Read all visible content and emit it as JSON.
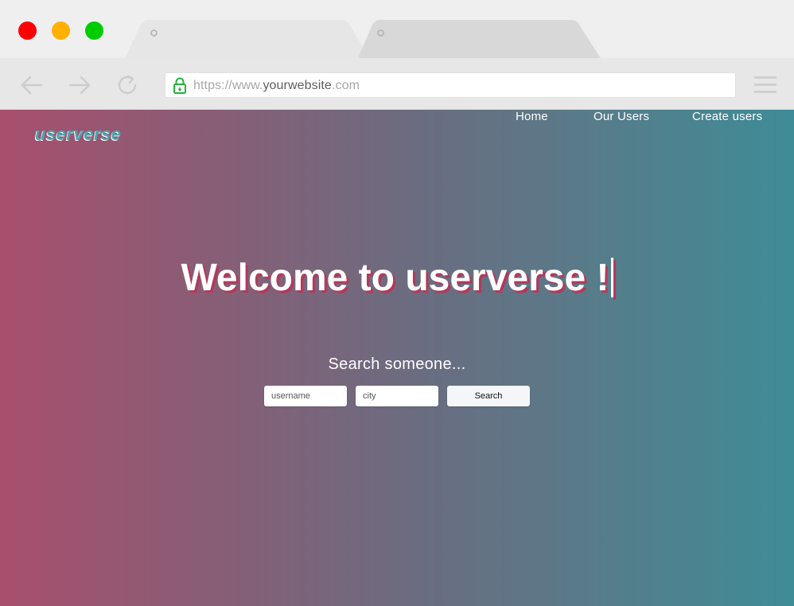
{
  "browser": {
    "traffic_lights": {
      "close_color": "#ff0000",
      "minimize_color": "#ffb000",
      "maximize_color": "#00cc00"
    },
    "tabs": [
      {
        "state": "active",
        "color": "#e6e6e6"
      },
      {
        "state": "inactive",
        "color": "#d8d8d8"
      }
    ],
    "url": {
      "prefix": "https://www.",
      "domain": "yourwebsite",
      "suffix": ".com",
      "secure": true,
      "lock_color": "#22b33a"
    },
    "icons": [
      "back-arrow-icon",
      "forward-arrow-icon",
      "reload-icon",
      "lock-icon",
      "hamburger-menu-icon"
    ]
  },
  "site": {
    "logo": "userverse",
    "nav": {
      "home": "Home",
      "users": "Our Users",
      "create": "Create users"
    },
    "hero": {
      "title": "Welcome to userverse !"
    },
    "search": {
      "caption": "Search someone...",
      "username_placeholder": "username",
      "city_placeholder": "city",
      "button_label": "Search"
    },
    "colors": {
      "gradient_left": "#a84f6d",
      "gradient_right": "#3e8c97",
      "title_shadow": "#b13a5a",
      "logo": "#4aa6b0"
    }
  }
}
